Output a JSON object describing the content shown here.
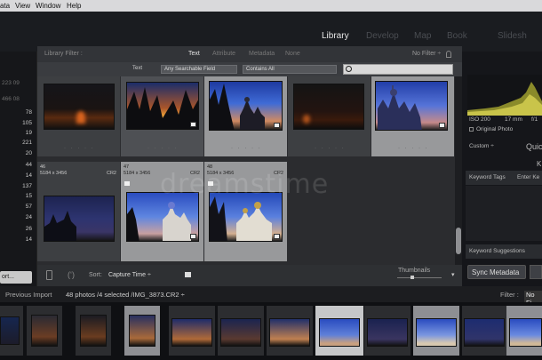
{
  "menubar": {
    "items": [
      "ata",
      "View",
      "Window",
      "Help"
    ]
  },
  "modules": {
    "items": [
      "Library",
      "Develop",
      "Map",
      "Book",
      "Slidesh"
    ]
  },
  "left_panel": {
    "counts": [
      {
        "label": "223 09",
        "value": ""
      },
      {
        "label": "466 08",
        "value": ""
      },
      {
        "label": "",
        "value": "78"
      },
      {
        "label": "",
        "value": "105"
      },
      {
        "label": "",
        "value": "19"
      },
      {
        "label": "",
        "value": "221"
      },
      {
        "label": "",
        "value": "20"
      },
      {
        "label": "",
        "value": "44"
      },
      {
        "label": "",
        "value": "14"
      },
      {
        "label": "",
        "value": "137"
      },
      {
        "label": "",
        "value": "15"
      },
      {
        "label": "",
        "value": "57"
      },
      {
        "label": "",
        "value": "24"
      },
      {
        "label": "",
        "value": "26"
      },
      {
        "label": "",
        "value": "14"
      }
    ],
    "import_label": "ort..."
  },
  "filter_bar": {
    "title": "Library Filter :",
    "tabs": [
      "Text",
      "Attribute",
      "Metadata",
      "None"
    ],
    "preset": "No Filter ÷",
    "row2_label": "Text",
    "field_dropdown": "Any Searchable Field",
    "rule_dropdown": "Contains All"
  },
  "grid": {
    "row2_meta": [
      {
        "index": "46",
        "size": "5184 x 3456",
        "ext": "CR2"
      },
      {
        "index": "47",
        "size": "5184 x 3456",
        "ext": "CR2"
      },
      {
        "index": "48",
        "size": "5184 x 3456",
        "ext": "CR2"
      }
    ]
  },
  "toolbar": {
    "sort_label": "Sort:",
    "sort_value": "Capture Time ÷",
    "thumbnails_label": "Thumbnails"
  },
  "right_panel": {
    "iso": "ISO 200",
    "focal": "17 mm",
    "fstop": "f/1",
    "original_photo": "Original Photo",
    "custom": "Custom ÷",
    "quick": "Quic",
    "k_letter": "K",
    "keyword_tags": "Keyword Tags",
    "enter_keywords": "Enter Ke",
    "keyword_suggestions": "Keyword Suggestions",
    "sync_metadata": "Sync Metadata"
  },
  "filmstrip_header": {
    "previous_import": "Previous Import",
    "summary": "48 photos /4 selected /IMG_3873.CR2 ÷",
    "filter_label": "Filter :",
    "filter_value": "No Fi"
  },
  "watermark": "dreamstime",
  "colors": {
    "sky_blue": "#3a5fc8",
    "sunset_orange": "#e0742c",
    "panel_bg": "#2b2c2f",
    "selected_cell": "#98999b"
  }
}
